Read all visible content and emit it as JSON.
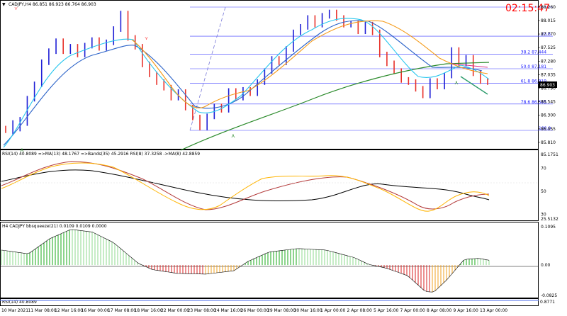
{
  "header": {
    "symbol_line": "CADJPY,H4  86.851 86.923 86.764 86.903",
    "timer": "02:15:47",
    "current_price": "86.903"
  },
  "price_axis": [
    "88.260",
    "88.015",
    "87.770",
    "87.525",
    "87.280",
    "87.035",
    "86.790",
    "86.545",
    "86.300",
    "86.055",
    "85.810"
  ],
  "fib_levels": [
    {
      "label": "23.6",
      "ratio": 0.236
    },
    {
      "label": "38.2  87.444",
      "ratio": 0.382
    },
    {
      "label": "50.0  87.181",
      "ratio": 0.5
    },
    {
      "label": "61.8  86.919",
      "ratio": 0.618
    },
    {
      "label": "78.6  86.545",
      "ratio": 0.786
    },
    {
      "label": "100.0",
      "ratio": 1.0
    }
  ],
  "rsi_panel": {
    "label": "RSI(14) 40.8089  =>MA(13) 48.1767  =>Bands(35) 45.2916  RSI(8) 37.3258  ->MA(8) 42.8859",
    "axis": [
      "85.1751",
      "70",
      "50",
      "30",
      "25.5132"
    ]
  },
  "squeeze_panel": {
    "label": "H4 CADJPY bbsqueeze(21) 0.0109 0.0109 0.0000",
    "axis": [
      "0.1095",
      "0.00",
      "-0.0825"
    ]
  },
  "mini_panel": {
    "label": "RSI(14) 40.8089",
    "axis": [
      "0.8771"
    ]
  },
  "time_axis": [
    "10 Mar 2021",
    "11 Mar 08:00",
    "12 Mar 16:00",
    "16 Mar 00:00",
    "17 Mar 08:00",
    "18 Mar 16:00",
    "22 Mar 00:00",
    "23 Mar 08:00",
    "24 Mar 16:00",
    "26 Mar 00:00",
    "29 Mar 08:00",
    "30 Mar 16:00",
    "1 Apr 00:00",
    "2 Apr 08:00",
    "5 Apr 16:00",
    "7 Apr 00:00",
    "8 Apr 08:00",
    "9 Apr 16:00",
    "13 Apr 00:00"
  ],
  "colors": {
    "bull_bar": "#1f1fd6",
    "bear_bar": "#e8312a",
    "fast_ma": "#26c6ee",
    "mid_ma": "#2a62c8",
    "orange_ma": "#f59a17",
    "long_ma": "#2a8a2a",
    "fib": "#3a3aff",
    "timer": "#ff0000",
    "rsi_line": "#ffb400",
    "rsi_ma": "#b33a3a",
    "rsi_bands": "#000000",
    "hist_green": "#18a818",
    "hist_red": "#d82020"
  },
  "chart_data": {
    "type": "candlestick",
    "price_ylim": [
      85.72,
      88.36
    ],
    "bars": [
      [
        86.06,
        86.03
      ],
      [
        86.0,
        86.16
      ],
      [
        86.06,
        86.22
      ],
      [
        86.16,
        86.6
      ],
      [
        86.6,
        86.86
      ],
      [
        86.86,
        87.26
      ],
      [
        87.26,
        87.46
      ],
      [
        87.46,
        87.64
      ],
      [
        87.64,
        87.46
      ],
      [
        87.46,
        87.54
      ],
      [
        87.54,
        87.4
      ],
      [
        87.4,
        87.56
      ],
      [
        87.56,
        87.66
      ],
      [
        87.66,
        87.52
      ],
      [
        87.52,
        87.62
      ],
      [
        87.62,
        87.86
      ],
      [
        87.86,
        88.14
      ],
      [
        88.14,
        87.7
      ],
      [
        87.7,
        87.54
      ],
      [
        87.54,
        87.22
      ],
      [
        87.22,
        87.04
      ],
      [
        87.04,
        86.9
      ],
      [
        86.9,
        86.8
      ],
      [
        86.8,
        86.62
      ],
      [
        86.62,
        86.72
      ],
      [
        86.72,
        86.44
      ],
      [
        86.44,
        86.26
      ],
      [
        86.26,
        86.08
      ],
      [
        86.08,
        86.28
      ],
      [
        86.28,
        86.46
      ],
      [
        86.46,
        86.4
      ],
      [
        86.4,
        86.74
      ],
      [
        86.74,
        86.62
      ],
      [
        86.62,
        86.76
      ],
      [
        86.76,
        86.7
      ],
      [
        86.7,
        86.9
      ],
      [
        86.9,
        87.1
      ],
      [
        87.1,
        87.32
      ],
      [
        87.32,
        87.26
      ],
      [
        87.26,
        87.5
      ],
      [
        87.5,
        87.8
      ],
      [
        87.8,
        87.9
      ],
      [
        87.9,
        88.06
      ],
      [
        88.06,
        87.94
      ],
      [
        87.94,
        88.1
      ],
      [
        88.1,
        88.16
      ],
      [
        88.16,
        88.06
      ],
      [
        88.06,
        87.94
      ],
      [
        87.94,
        87.96
      ],
      [
        87.96,
        87.82
      ],
      [
        87.82,
        87.94
      ],
      [
        87.94,
        87.8
      ],
      [
        87.8,
        87.4
      ],
      [
        87.4,
        87.24
      ],
      [
        87.24,
        87.1
      ],
      [
        87.1,
        86.94
      ],
      [
        86.94,
        86.9
      ],
      [
        86.9,
        86.78
      ],
      [
        86.78,
        86.66
      ],
      [
        86.66,
        86.92
      ],
      [
        86.92,
        86.82
      ],
      [
        86.82,
        87.02
      ],
      [
        87.02,
        87.48
      ],
      [
        87.48,
        87.24
      ],
      [
        87.24,
        87.34
      ],
      [
        87.34,
        87.06
      ],
      [
        87.06,
        86.92
      ],
      [
        86.92,
        86.9
      ]
    ],
    "rsi_ylim": [
      25.5132,
      85.1751
    ],
    "hist_ylim": [
      -0.0825,
      0.1095
    ]
  }
}
